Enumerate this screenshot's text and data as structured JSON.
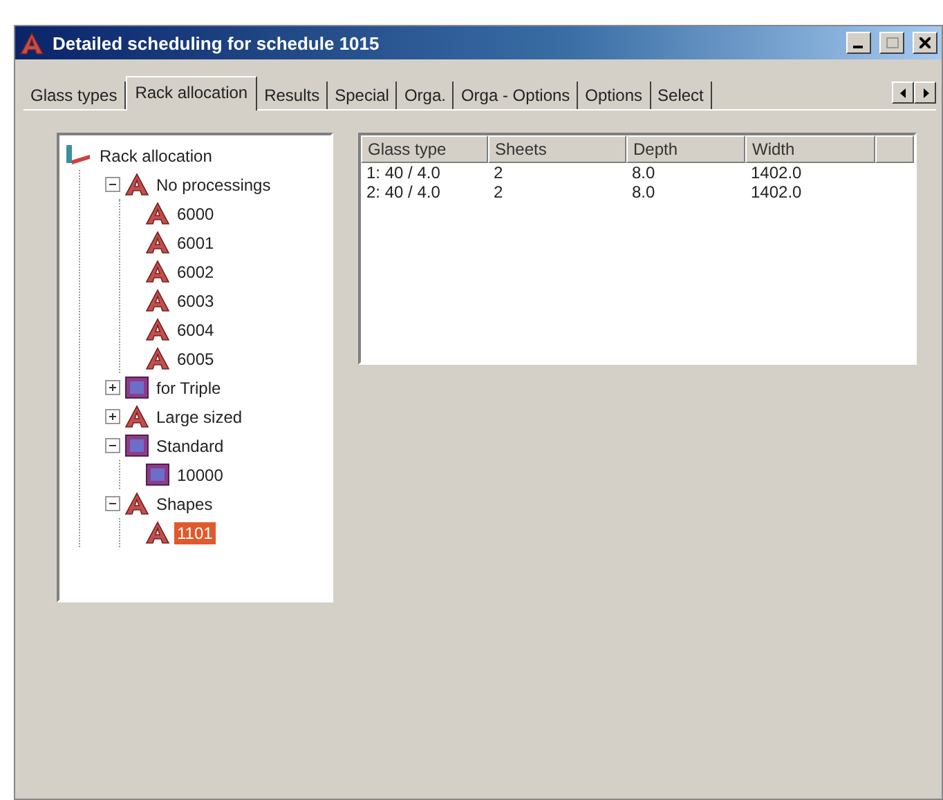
{
  "window": {
    "title": "Detailed scheduling for schedule 1015"
  },
  "tabs": [
    {
      "label": "Glass types",
      "selected": false
    },
    {
      "label": "Rack allocation",
      "selected": true
    },
    {
      "label": "Results",
      "selected": false
    },
    {
      "label": "Special",
      "selected": false
    },
    {
      "label": "Orga.",
      "selected": false
    },
    {
      "label": "Orga - Options",
      "selected": false
    },
    {
      "label": "Options",
      "selected": false
    },
    {
      "label": "Select",
      "selected": false
    }
  ],
  "tree": {
    "label": "Rack allocation",
    "kind": "root",
    "selected": false,
    "children": [
      {
        "label": "No processings",
        "kind": "a",
        "expanded": true,
        "selected": false,
        "children": [
          {
            "label": "6000",
            "kind": "a",
            "selected": false
          },
          {
            "label": "6001",
            "kind": "a",
            "selected": false
          },
          {
            "label": "6002",
            "kind": "a",
            "selected": false
          },
          {
            "label": "6003",
            "kind": "a",
            "selected": false
          },
          {
            "label": "6004",
            "kind": "a",
            "selected": false
          },
          {
            "label": "6005",
            "kind": "a",
            "selected": false
          }
        ]
      },
      {
        "label": "for Triple",
        "kind": "m",
        "expanded": false,
        "selected": false
      },
      {
        "label": "Large sized",
        "kind": "a",
        "expanded": false,
        "selected": false
      },
      {
        "label": "Standard",
        "kind": "m",
        "expanded": true,
        "selected": false,
        "children": [
          {
            "label": "10000",
            "kind": "m",
            "selected": false
          }
        ]
      },
      {
        "label": "Shapes",
        "kind": "a",
        "expanded": true,
        "selected": false,
        "children": [
          {
            "label": "1101",
            "kind": "a",
            "selected": true
          }
        ]
      }
    ]
  },
  "table": {
    "columns": [
      "Glass type",
      "Sheets",
      "Depth",
      "Width"
    ],
    "rows": [
      [
        "1: 40 / 4.0",
        "2",
        "8.0",
        "1402.0"
      ],
      [
        "2: 40 / 4.0",
        "2",
        "8.0",
        "1402.0"
      ]
    ]
  }
}
